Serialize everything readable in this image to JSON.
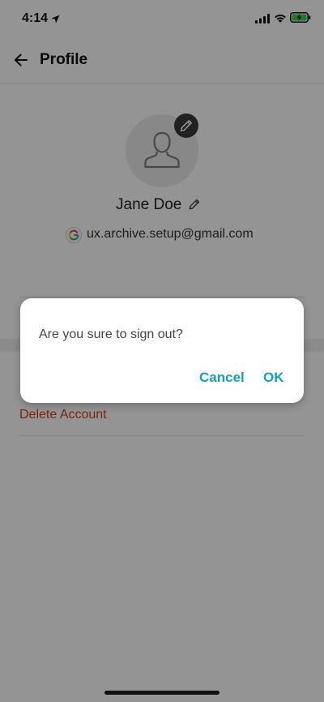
{
  "status_bar": {
    "time": "4:14"
  },
  "header": {
    "title": "Profile"
  },
  "profile": {
    "name": "Jane Doe",
    "email": "ux.archive.setup@gmail.com"
  },
  "actions": {
    "delete_account": "Delete Account"
  },
  "dialog": {
    "message": "Are you sure to sign out?",
    "cancel_label": "Cancel",
    "ok_label": "OK"
  },
  "colors": {
    "accent": "#1a9fb0",
    "danger": "#d0401b"
  }
}
